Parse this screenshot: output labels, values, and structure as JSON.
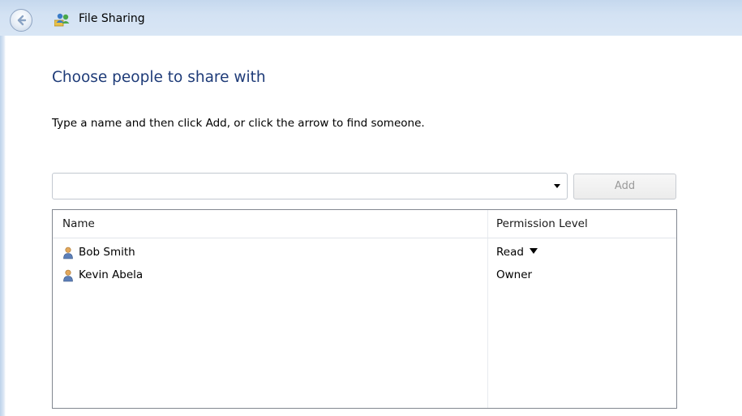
{
  "window": {
    "title": "File Sharing"
  },
  "main": {
    "heading": "Choose people to share with",
    "instructions": "Type a name and then click Add, or click the arrow to find someone.",
    "name_input": {
      "value": "",
      "placeholder": ""
    },
    "add_button_label": "Add"
  },
  "table": {
    "columns": [
      "Name",
      "Permission Level"
    ],
    "rows": [
      {
        "name": "Bob Smith",
        "permission": "Read",
        "has_dropdown": true
      },
      {
        "name": "Kevin Abela",
        "permission": "Owner",
        "has_dropdown": false
      }
    ]
  },
  "icons": {
    "back": "back-arrow-icon",
    "app": "file-sharing-icon",
    "user": "user-icon",
    "combo_dropdown": "chevron-down-icon",
    "permission_dropdown": "chevron-down-icon"
  },
  "colors": {
    "heading": "#1e3b78",
    "titlebar": "#d3e2f3",
    "disabled_text": "#9a9a9a"
  }
}
